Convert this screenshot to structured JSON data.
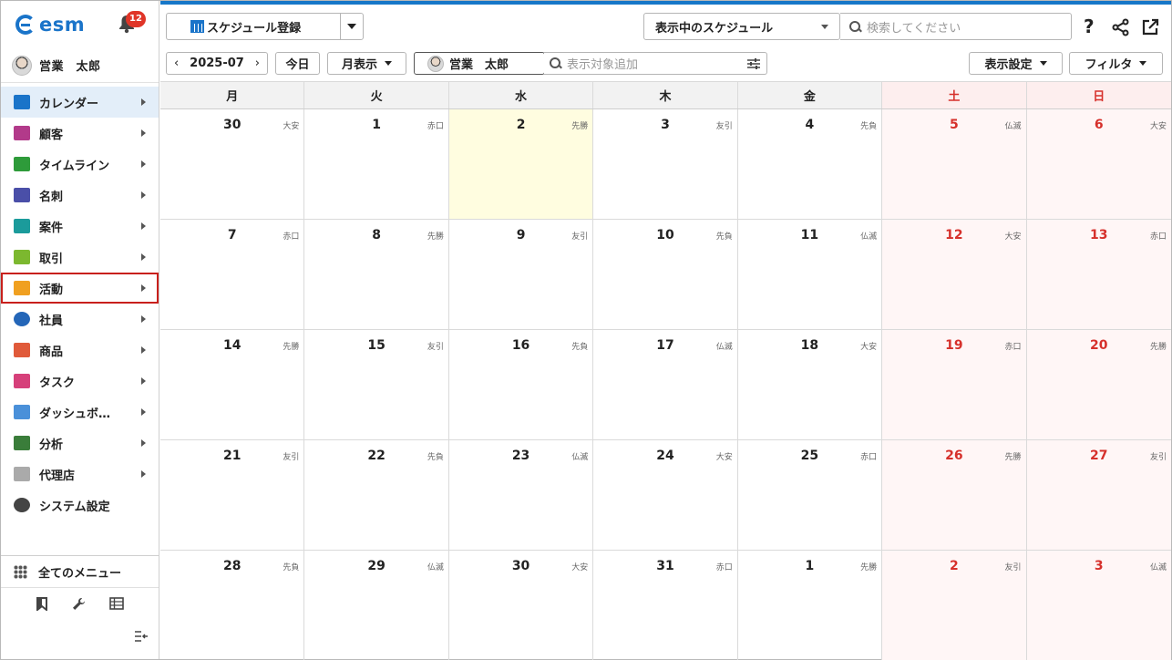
{
  "sidebar": {
    "logo": "esm",
    "notification_count": "12",
    "user_name": "営業　太郎",
    "items": [
      {
        "label": "カレンダー",
        "icon": "calendar-icon",
        "color": "#1a74c9",
        "active": true
      },
      {
        "label": "顧客",
        "icon": "building-icon",
        "color": "#b23a8a"
      },
      {
        "label": "タイムライン",
        "icon": "chat-icon",
        "color": "#2e9b3a"
      },
      {
        "label": "名刺",
        "icon": "card-icon",
        "color": "#4a4fa8"
      },
      {
        "label": "案件",
        "icon": "folder-icon",
        "color": "#1b9b9b"
      },
      {
        "label": "取引",
        "icon": "deal-icon",
        "color": "#7cb82f"
      },
      {
        "label": "活動",
        "icon": "clipboard-icon",
        "color": "#f0a020",
        "highlighted": true
      },
      {
        "label": "社員",
        "icon": "person-icon",
        "color": "#2466b8"
      },
      {
        "label": "商品",
        "icon": "product-icon",
        "color": "#e05a3a"
      },
      {
        "label": "タスク",
        "icon": "check-icon",
        "color": "#d6407a"
      },
      {
        "label": "ダッシュボ…",
        "icon": "dashboard-icon",
        "color": "#4a90d9"
      },
      {
        "label": "分析",
        "icon": "chart-icon",
        "color": "#3a7d3a"
      },
      {
        "label": "代理店",
        "icon": "document-icon",
        "color": "#aaaaaa"
      },
      {
        "label": "システム設定",
        "icon": "gear-icon",
        "color": "#444444"
      }
    ],
    "all_menu": "全てのメニュー"
  },
  "toolbar": {
    "register_label": "スケジュール登録",
    "view_select": "表示中のスケジュール",
    "search_placeholder": "検索してください",
    "help": "?",
    "month": "2025-07",
    "today_label": "今日",
    "view_mode": "月表示",
    "person": "営業　太郎",
    "add_target_placeholder": "表示対象追加",
    "display_settings": "表示設定",
    "filter": "フィルタ"
  },
  "calendar": {
    "weekdays": [
      "月",
      "火",
      "水",
      "木",
      "金",
      "土",
      "日"
    ],
    "weeks": [
      [
        {
          "d": "30",
          "r": "大安"
        },
        {
          "d": "1",
          "r": "赤口"
        },
        {
          "d": "2",
          "r": "先勝",
          "today": true
        },
        {
          "d": "3",
          "r": "友引"
        },
        {
          "d": "4",
          "r": "先負"
        },
        {
          "d": "5",
          "r": "仏滅"
        },
        {
          "d": "6",
          "r": "大安"
        }
      ],
      [
        {
          "d": "7",
          "r": "赤口"
        },
        {
          "d": "8",
          "r": "先勝"
        },
        {
          "d": "9",
          "r": "友引"
        },
        {
          "d": "10",
          "r": "先負"
        },
        {
          "d": "11",
          "r": "仏滅"
        },
        {
          "d": "12",
          "r": "大安"
        },
        {
          "d": "13",
          "r": "赤口"
        }
      ],
      [
        {
          "d": "14",
          "r": "先勝"
        },
        {
          "d": "15",
          "r": "友引"
        },
        {
          "d": "16",
          "r": "先負"
        },
        {
          "d": "17",
          "r": "仏滅"
        },
        {
          "d": "18",
          "r": "大安"
        },
        {
          "d": "19",
          "r": "赤口"
        },
        {
          "d": "20",
          "r": "先勝"
        }
      ],
      [
        {
          "d": "21",
          "r": "友引"
        },
        {
          "d": "22",
          "r": "先負"
        },
        {
          "d": "23",
          "r": "仏滅"
        },
        {
          "d": "24",
          "r": "大安"
        },
        {
          "d": "25",
          "r": "赤口"
        },
        {
          "d": "26",
          "r": "先勝"
        },
        {
          "d": "27",
          "r": "友引"
        }
      ],
      [
        {
          "d": "28",
          "r": "先負"
        },
        {
          "d": "29",
          "r": "仏滅"
        },
        {
          "d": "30",
          "r": "大安"
        },
        {
          "d": "31",
          "r": "赤口"
        },
        {
          "d": "1",
          "r": "先勝"
        },
        {
          "d": "2",
          "r": "友引"
        },
        {
          "d": "3",
          "r": "仏滅"
        }
      ]
    ]
  }
}
